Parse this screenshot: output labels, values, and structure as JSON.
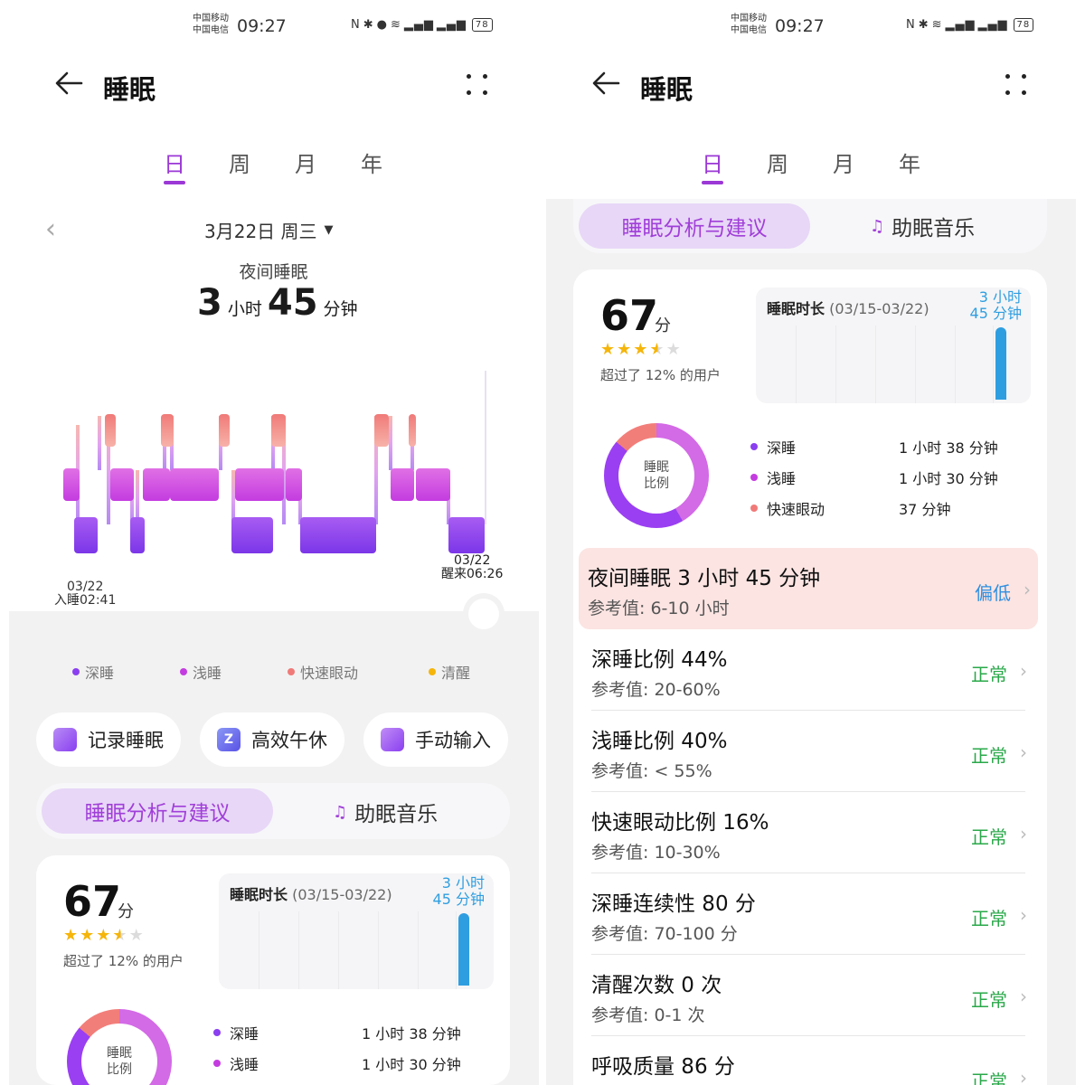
{
  "status_bar": {
    "carrier1": "中国移动",
    "carrier2": "中国电信",
    "time": "09:27",
    "battery": "78",
    "icons": [
      "nfc-icon",
      "bluetooth-icon",
      "location-icon",
      "wifi-icon",
      "signal-icon"
    ]
  },
  "header": {
    "title": "睡眠"
  },
  "period_tabs": [
    "日",
    "周",
    "月",
    "年"
  ],
  "active_tab": "日",
  "date_selector": {
    "label": "3月22日 周三",
    "arrow": "▼",
    "prev": "‹"
  },
  "night_sleep": {
    "label": "夜间睡眠",
    "hours": "3",
    "hours_unit": "小时",
    "minutes": "45",
    "minutes_unit": "分钟"
  },
  "hypnogram": {
    "start_date": "03/22",
    "start_label": "入睡02:41",
    "end_date": "03/22",
    "end_label": "醒来06:26"
  },
  "legend": [
    {
      "label": "深睡",
      "color": "#8a3ff0"
    },
    {
      "label": "浅睡",
      "color": "#c43ce0"
    },
    {
      "label": "快速眼动",
      "color": "#f07a78"
    },
    {
      "label": "清醒",
      "color": "#f5b50a"
    }
  ],
  "actions": [
    {
      "label": "记录睡眠",
      "icon": "moon-note-icon"
    },
    {
      "label": "高效午休",
      "icon": "nap-zz-icon"
    },
    {
      "label": "手动输入",
      "icon": "edit-icon"
    }
  ],
  "segments": {
    "analysis": "睡眠分析与建议",
    "music": "助眠音乐",
    "music_icon": "♫"
  },
  "score": {
    "value": "67",
    "unit": "分",
    "rating": 3.5,
    "exceed_text": "超过了 12% 的用户"
  },
  "duration_chart": {
    "title": "睡眠时长",
    "range": "(03/15-03/22)",
    "value_line1": "3 小时",
    "value_line2": "45 分钟"
  },
  "ratio": {
    "center_line1": "睡眠",
    "center_line2": "比例",
    "colors": {
      "deep": "#9a3ff2",
      "light": "#d36ae6",
      "rem": "#f27e7a"
    },
    "items": [
      {
        "label": "深睡",
        "value": "1 小时 38 分钟",
        "color": "#8a3ff0"
      },
      {
        "label": "浅睡",
        "value": "1 小时 30 分钟",
        "color": "#c43ce0"
      },
      {
        "label": "快速眼动",
        "value": "37 分钟",
        "color": "#f07a78"
      }
    ]
  },
  "metrics": [
    {
      "title": "夜间睡眠  3 小时 45 分钟",
      "ref": "参考值:  6-10 小时",
      "status": "偏低",
      "level": "low"
    },
    {
      "title": "深睡比例  44%",
      "ref": "参考值:  20-60%",
      "status": "正常",
      "level": "ok"
    },
    {
      "title": "浅睡比例  40%",
      "ref": "参考值:  < 55%",
      "status": "正常",
      "level": "ok"
    },
    {
      "title": "快速眼动比例  16%",
      "ref": "参考值:  10-30%",
      "status": "正常",
      "level": "ok"
    },
    {
      "title": "深睡连续性  80 分",
      "ref": "参考值:  70-100 分",
      "status": "正常",
      "level": "ok"
    },
    {
      "title": "清醒次数  0 次",
      "ref": "参考值:  0-1 次",
      "status": "正常",
      "level": "ok"
    },
    {
      "title": "呼吸质量  86 分",
      "ref": "",
      "status": "正常",
      "level": "ok"
    }
  ]
}
